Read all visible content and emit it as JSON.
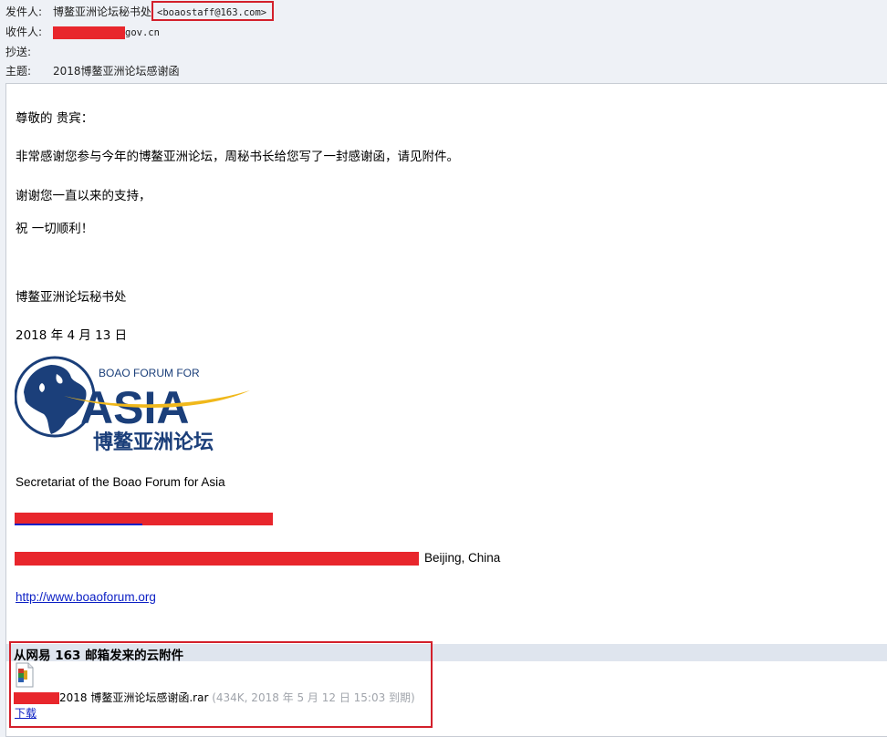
{
  "header": {
    "from_label": "发件人:",
    "from_name": "博鳌亚洲论坛秘书处",
    "from_email": "<boaostaff@163.com>",
    "to_label": "收件人:",
    "to_suffix": "gov.cn",
    "cc_label": "抄送:",
    "subject_label": "主题:",
    "subject": "2018博鳌亚洲论坛感谢函"
  },
  "body": {
    "greeting": "尊敬的 贵宾：",
    "line1": "非常感谢您参与今年的博鳌亚洲论坛，周秘书长给您写了一封感谢函，请见附件。",
    "line2": "谢谢您一直以来的支持，",
    "line3": "祝 一切顺利！",
    "signature": "博鳌亚洲论坛秘书处",
    "date": "2018 年 4 月 13 日",
    "logo": {
      "top_text": "BOAO FORUM FOR",
      "main_text": "ASIA",
      "cn_text": "博鳌亚洲论坛"
    },
    "secretariat": "Secretariat of the Boao Forum for Asia",
    "address_suffix": "Beijing, China",
    "website": "http://www.boaoforum.org"
  },
  "attachment": {
    "title": "从网易 163 邮箱发来的云附件",
    "file_name": "2018 博鳌亚洲论坛感谢函.rar",
    "file_meta": "(434K, 2018 年 5 月 12 日 15:03 到期)",
    "download_label": "下载"
  },
  "colors": {
    "highlight_box": "#d3202b",
    "redaction": "#e8262c",
    "link": "#0b1fc4",
    "logo_blue": "#1b3f7a",
    "logo_gold": "#f0b81b"
  }
}
